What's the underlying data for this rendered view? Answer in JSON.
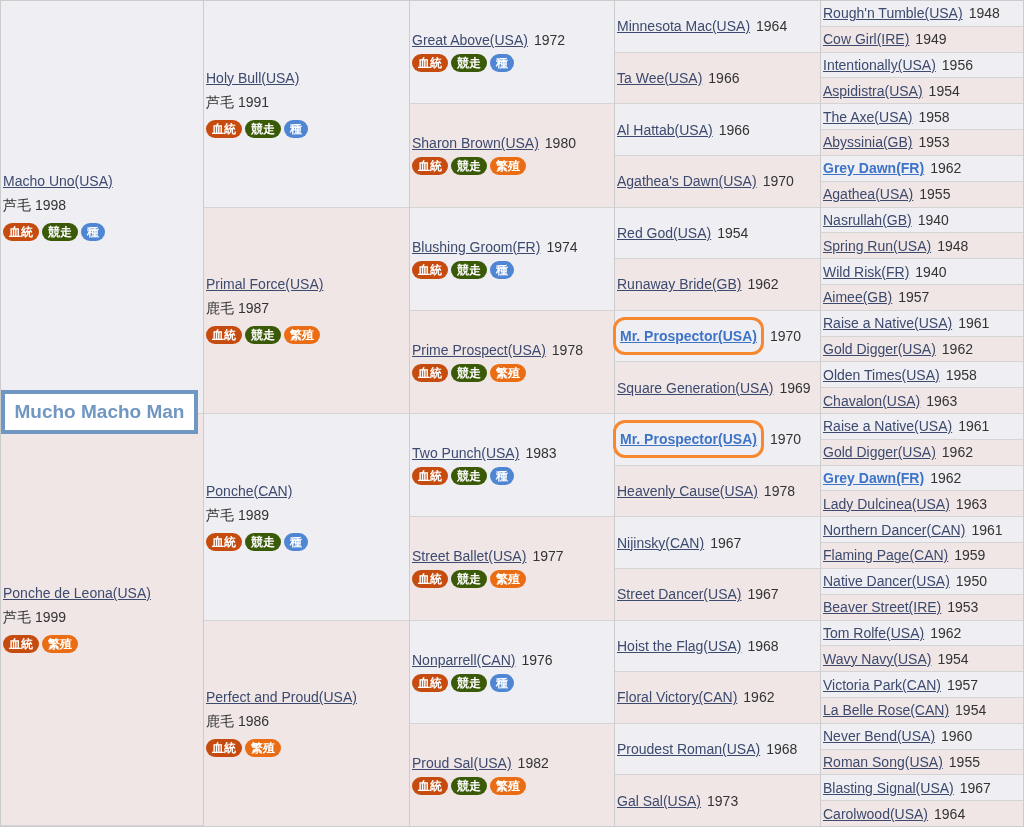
{
  "title": "Mucho Macho Man",
  "gen1": [
    {
      "name": "Macho Uno(USA)",
      "coat": "芦毛",
      "year": "1998",
      "badges": [
        {
          "kind": "blood",
          "label": "血統"
        },
        {
          "kind": "race",
          "label": "競走"
        },
        {
          "kind": "stud",
          "label": "種"
        }
      ]
    },
    {
      "name": "Ponche de Leona(USA)",
      "coat": "芦毛",
      "year": "1999",
      "badges": [
        {
          "kind": "blood",
          "label": "血統"
        },
        {
          "kind": "mare",
          "label": "繁殖"
        }
      ]
    }
  ],
  "gen2": [
    {
      "name": "Holy Bull(USA)",
      "coat": "芦毛",
      "year": "1991",
      "badges": [
        {
          "kind": "blood",
          "label": "血統"
        },
        {
          "kind": "race",
          "label": "競走"
        },
        {
          "kind": "stud",
          "label": "種"
        }
      ]
    },
    {
      "name": "Primal Force(USA)",
      "coat": "鹿毛",
      "year": "1987",
      "badges": [
        {
          "kind": "blood",
          "label": "血統"
        },
        {
          "kind": "race",
          "label": "競走"
        },
        {
          "kind": "mare",
          "label": "繁殖"
        }
      ]
    },
    {
      "name": "Ponche(CAN)",
      "coat": "芦毛",
      "year": "1989",
      "badges": [
        {
          "kind": "blood",
          "label": "血統"
        },
        {
          "kind": "race",
          "label": "競走"
        },
        {
          "kind": "stud",
          "label": "種"
        }
      ]
    },
    {
      "name": "Perfect and Proud(USA)",
      "coat": "鹿毛",
      "year": "1986",
      "badges": [
        {
          "kind": "blood",
          "label": "血統"
        },
        {
          "kind": "mare",
          "label": "繁殖"
        }
      ]
    }
  ],
  "gen3": [
    {
      "name": "Great Above(USA)",
      "year": "1972",
      "badges": [
        {
          "kind": "blood",
          "label": "血統"
        },
        {
          "kind": "race",
          "label": "競走"
        },
        {
          "kind": "stud",
          "label": "種"
        }
      ]
    },
    {
      "name": "Sharon Brown(USA)",
      "year": "1980",
      "badges": [
        {
          "kind": "blood",
          "label": "血統"
        },
        {
          "kind": "race",
          "label": "競走"
        },
        {
          "kind": "mare",
          "label": "繁殖"
        }
      ]
    },
    {
      "name": "Blushing Groom(FR)",
      "year": "1974",
      "badges": [
        {
          "kind": "blood",
          "label": "血統"
        },
        {
          "kind": "race",
          "label": "競走"
        },
        {
          "kind": "stud",
          "label": "種"
        }
      ]
    },
    {
      "name": "Prime Prospect(USA)",
      "year": "1978",
      "badges": [
        {
          "kind": "blood",
          "label": "血統"
        },
        {
          "kind": "race",
          "label": "競走"
        },
        {
          "kind": "mare",
          "label": "繁殖"
        }
      ]
    },
    {
      "name": "Two Punch(USA)",
      "year": "1983",
      "badges": [
        {
          "kind": "blood",
          "label": "血統"
        },
        {
          "kind": "race",
          "label": "競走"
        },
        {
          "kind": "stud",
          "label": "種"
        }
      ]
    },
    {
      "name": "Street Ballet(USA)",
      "year": "1977",
      "badges": [
        {
          "kind": "blood",
          "label": "血統"
        },
        {
          "kind": "race",
          "label": "競走"
        },
        {
          "kind": "mare",
          "label": "繁殖"
        }
      ]
    },
    {
      "name": "Nonparrell(CAN)",
      "year": "1976",
      "badges": [
        {
          "kind": "blood",
          "label": "血統"
        },
        {
          "kind": "race",
          "label": "競走"
        },
        {
          "kind": "stud",
          "label": "種"
        }
      ]
    },
    {
      "name": "Proud Sal(USA)",
      "year": "1982",
      "badges": [
        {
          "kind": "blood",
          "label": "血統"
        },
        {
          "kind": "race",
          "label": "競走"
        },
        {
          "kind": "mare",
          "label": "繁殖"
        }
      ]
    }
  ],
  "gen4": [
    {
      "name": "Minnesota Mac(USA)",
      "year": "1964",
      "highlighted": false,
      "circled": false
    },
    {
      "name": "Ta Wee(USA)",
      "year": "1966",
      "highlighted": false,
      "circled": false
    },
    {
      "name": "Al Hattab(USA)",
      "year": "1966",
      "highlighted": false,
      "circled": false
    },
    {
      "name": "Agathea's Dawn(USA)",
      "year": "1970",
      "highlighted": false,
      "circled": false
    },
    {
      "name": "Red God(USA)",
      "year": "1954",
      "highlighted": false,
      "circled": false
    },
    {
      "name": "Runaway Bride(GB)",
      "year": "1962",
      "highlighted": false,
      "circled": false
    },
    {
      "name": "Mr. Prospector(USA)",
      "year": "1970",
      "highlighted": true,
      "circled": true
    },
    {
      "name": "Square Generation(USA)",
      "year": "1969",
      "highlighted": false,
      "circled": false
    },
    {
      "name": "Mr. Prospector(USA)",
      "year": "1970",
      "highlighted": true,
      "circled": true
    },
    {
      "name": "Heavenly Cause(USA)",
      "year": "1978",
      "highlighted": false,
      "circled": false
    },
    {
      "name": "Nijinsky(CAN)",
      "year": "1967",
      "highlighted": false,
      "circled": false
    },
    {
      "name": "Street Dancer(USA)",
      "year": "1967",
      "highlighted": false,
      "circled": false
    },
    {
      "name": "Hoist the Flag(USA)",
      "year": "1968",
      "highlighted": false,
      "circled": false
    },
    {
      "name": "Floral Victory(CAN)",
      "year": "1962",
      "highlighted": false,
      "circled": false
    },
    {
      "name": "Proudest Roman(USA)",
      "year": "1968",
      "highlighted": false,
      "circled": false
    },
    {
      "name": "Gal Sal(USA)",
      "year": "1973",
      "highlighted": false,
      "circled": false
    }
  ],
  "gen5": [
    {
      "name": "Rough'n Tumble(USA)",
      "year": "1948",
      "highlighted": false
    },
    {
      "name": "Cow Girl(IRE)",
      "year": "1949",
      "highlighted": false
    },
    {
      "name": "Intentionally(USA)",
      "year": "1956",
      "highlighted": false
    },
    {
      "name": "Aspidistra(USA)",
      "year": "1954",
      "highlighted": false
    },
    {
      "name": "The Axe(USA)",
      "year": "1958",
      "highlighted": false
    },
    {
      "name": "Abyssinia(GB)",
      "year": "1953",
      "highlighted": false
    },
    {
      "name": "Grey Dawn(FR)",
      "year": "1962",
      "highlighted": true
    },
    {
      "name": "Agathea(USA)",
      "year": "1955",
      "highlighted": false
    },
    {
      "name": "Nasrullah(GB)",
      "year": "1940",
      "highlighted": false
    },
    {
      "name": "Spring Run(USA)",
      "year": "1948",
      "highlighted": false
    },
    {
      "name": "Wild Risk(FR)",
      "year": "1940",
      "highlighted": false
    },
    {
      "name": "Aimee(GB)",
      "year": "1957",
      "highlighted": false
    },
    {
      "name": "Raise a Native(USA)",
      "year": "1961",
      "highlighted": false
    },
    {
      "name": "Gold Digger(USA)",
      "year": "1962",
      "highlighted": false
    },
    {
      "name": "Olden Times(USA)",
      "year": "1958",
      "highlighted": false
    },
    {
      "name": "Chavalon(USA)",
      "year": "1963",
      "highlighted": false
    },
    {
      "name": "Raise a Native(USA)",
      "year": "1961",
      "highlighted": false
    },
    {
      "name": "Gold Digger(USA)",
      "year": "1962",
      "highlighted": false
    },
    {
      "name": "Grey Dawn(FR)",
      "year": "1962",
      "highlighted": true
    },
    {
      "name": "Lady Dulcinea(USA)",
      "year": "1963",
      "highlighted": false
    },
    {
      "name": "Northern Dancer(CAN)",
      "year": "1961",
      "highlighted": false
    },
    {
      "name": "Flaming Page(CAN)",
      "year": "1959",
      "highlighted": false
    },
    {
      "name": "Native Dancer(USA)",
      "year": "1950",
      "highlighted": false
    },
    {
      "name": "Beaver Street(IRE)",
      "year": "1953",
      "highlighted": false
    },
    {
      "name": "Tom Rolfe(USA)",
      "year": "1962",
      "highlighted": false
    },
    {
      "name": "Wavy Navy(USA)",
      "year": "1954",
      "highlighted": false
    },
    {
      "name": "Victoria Park(CAN)",
      "year": "1957",
      "highlighted": false
    },
    {
      "name": "La Belle Rose(CAN)",
      "year": "1954",
      "highlighted": false
    },
    {
      "name": "Never Bend(USA)",
      "year": "1960",
      "highlighted": false
    },
    {
      "name": "Roman Song(USA)",
      "year": "1955",
      "highlighted": false
    },
    {
      "name": "Blasting Signal(USA)",
      "year": "1967",
      "highlighted": false
    },
    {
      "name": "Carolwood(USA)",
      "year": "1964",
      "highlighted": false
    }
  ]
}
